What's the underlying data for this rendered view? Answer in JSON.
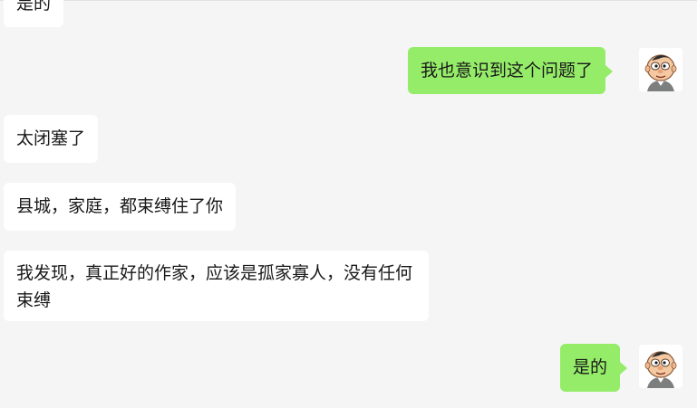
{
  "conversation": {
    "messages": [
      {
        "sender": "them",
        "text": "是的"
      },
      {
        "sender": "me",
        "text": "我也意识到这个问题了"
      },
      {
        "sender": "them",
        "text": "太闭塞了"
      },
      {
        "sender": "them",
        "text": "县城，家庭，都束缚住了你"
      },
      {
        "sender": "them",
        "text": "我发现，真正好的作家，应该是孤家寡人，没有任何束缚"
      },
      {
        "sender": "me",
        "text": "是的"
      }
    ]
  },
  "avatar": {
    "icon": "cartoon-boy-avatar-icon"
  },
  "colors": {
    "background": "#f5f5f5",
    "incoming_bubble": "#ffffff",
    "outgoing_bubble": "#95ec69"
  }
}
